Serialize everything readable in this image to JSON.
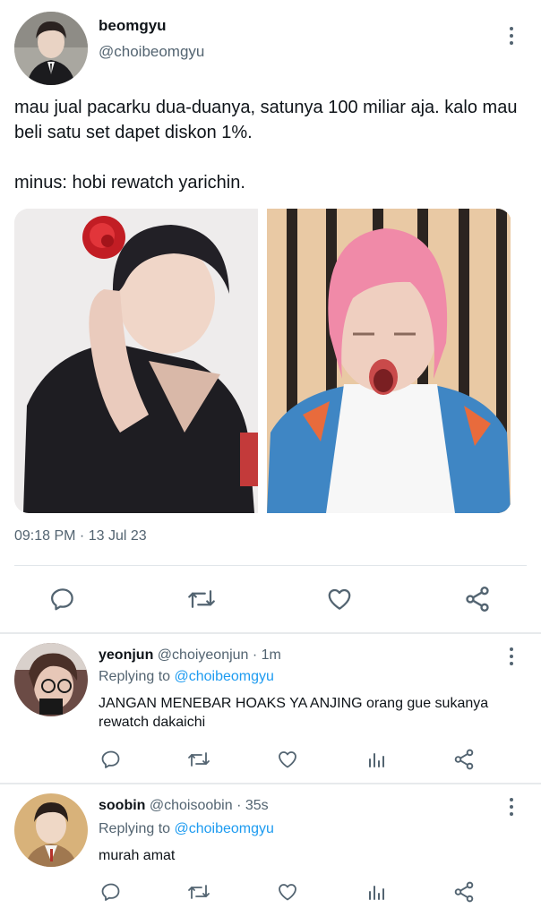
{
  "tweet": {
    "author_name": "beomgyu",
    "author_handle": "@choibeomgyu",
    "text_line1": "mau jual pacarku dua-duanya, satunya 100 miliar aja. kalo mau beli satu set dapet diskon 1%.",
    "text_line2": "minus: hobi rewatch yarichin.",
    "timestamp": "09:18 PM · 13 Jul 23"
  },
  "replies": [
    {
      "name": "yeonjun",
      "meta": "@choiyeonjun · 1m",
      "replying_prefix": "Replying to",
      "replying_to": "@choibeomgyu",
      "text": "JANGAN MENEBAR HOAKS YA ANJING orang gue sukanya rewatch dakaichi"
    },
    {
      "name": "soobin",
      "meta": "@choisoobin · 35s",
      "replying_prefix": "Replying to",
      "replying_to": "@choibeomgyu",
      "text": "murah amat"
    }
  ],
  "icons": {
    "reply": "comment-icon",
    "retweet": "retweet-icon",
    "like": "heart-icon",
    "share": "share-icon",
    "analytics": "analytics-icon",
    "more": "more-vertical-icon"
  },
  "colors": {
    "text": "#0f1419",
    "muted": "#536471",
    "link": "#1d9bf0",
    "divider": "#e1e6ea"
  }
}
